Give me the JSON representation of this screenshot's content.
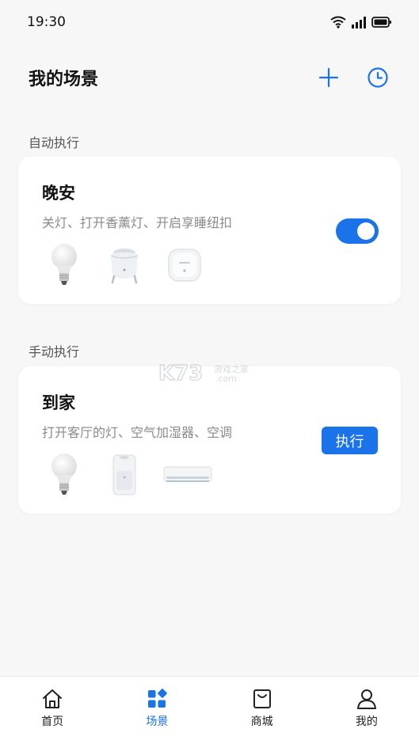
{
  "status_bar": {
    "time": "19:30"
  },
  "header": {
    "title": "我的场景"
  },
  "sections": {
    "auto_label": "自动执行",
    "manual_label": "手动执行"
  },
  "scenes": {
    "auto": {
      "title": "晚安",
      "desc": "关灯、打开香薰灯、开启享睡纽扣",
      "enabled": true
    },
    "manual": {
      "title": "到家",
      "desc": "打开客厅的灯、空气加湿器、空调",
      "exec_label": "执行"
    }
  },
  "tabs": [
    {
      "label": "首页",
      "icon": "home-icon",
      "active": false
    },
    {
      "label": "场景",
      "icon": "scene-icon",
      "active": true
    },
    {
      "label": "商城",
      "icon": "shop-bag-icon",
      "active": false
    },
    {
      "label": "我的",
      "icon": "person-icon",
      "active": false
    }
  ],
  "colors": {
    "accent": "#1a73e8",
    "background": "#f7f7f7",
    "card": "#ffffff"
  }
}
